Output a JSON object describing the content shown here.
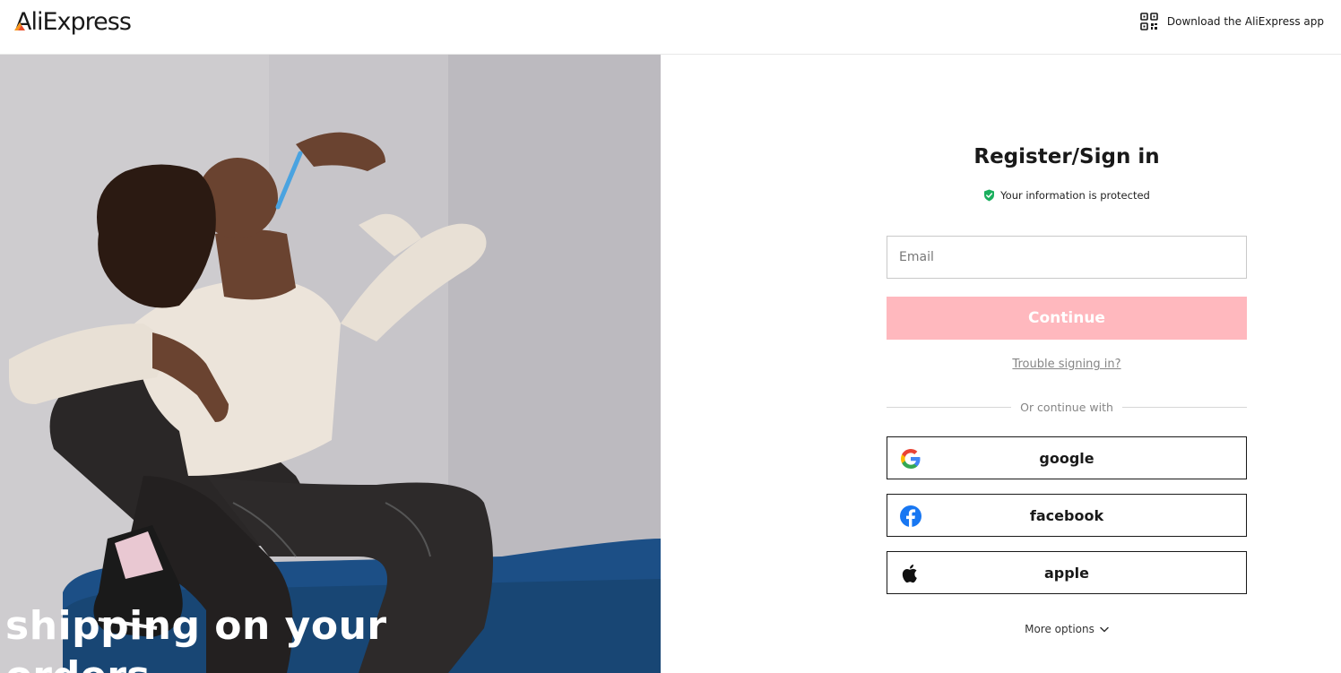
{
  "header": {
    "logo_text": "AliExpress",
    "download_app_label": "Download the AliExpress app"
  },
  "hero": {
    "promo_line1": "shipping on your",
    "promo_line2": "orders"
  },
  "signin": {
    "title": "Register/Sign in",
    "protected_label": "Your information is protected",
    "email_placeholder": "Email",
    "email_value": "",
    "continue_label": "Continue",
    "trouble_label": "Trouble signing in?",
    "divider_label": "Or continue with",
    "social": [
      {
        "label": "google",
        "icon": "google-icon"
      },
      {
        "label": "facebook",
        "icon": "facebook-icon"
      },
      {
        "label": "apple",
        "icon": "apple-icon"
      }
    ],
    "more_options_label": "More options"
  },
  "colors": {
    "continue_disabled": "#ffb8be",
    "protected_green": "#1aaf5d",
    "facebook_blue": "#1877f2",
    "logo_accent": "#f7971d"
  }
}
